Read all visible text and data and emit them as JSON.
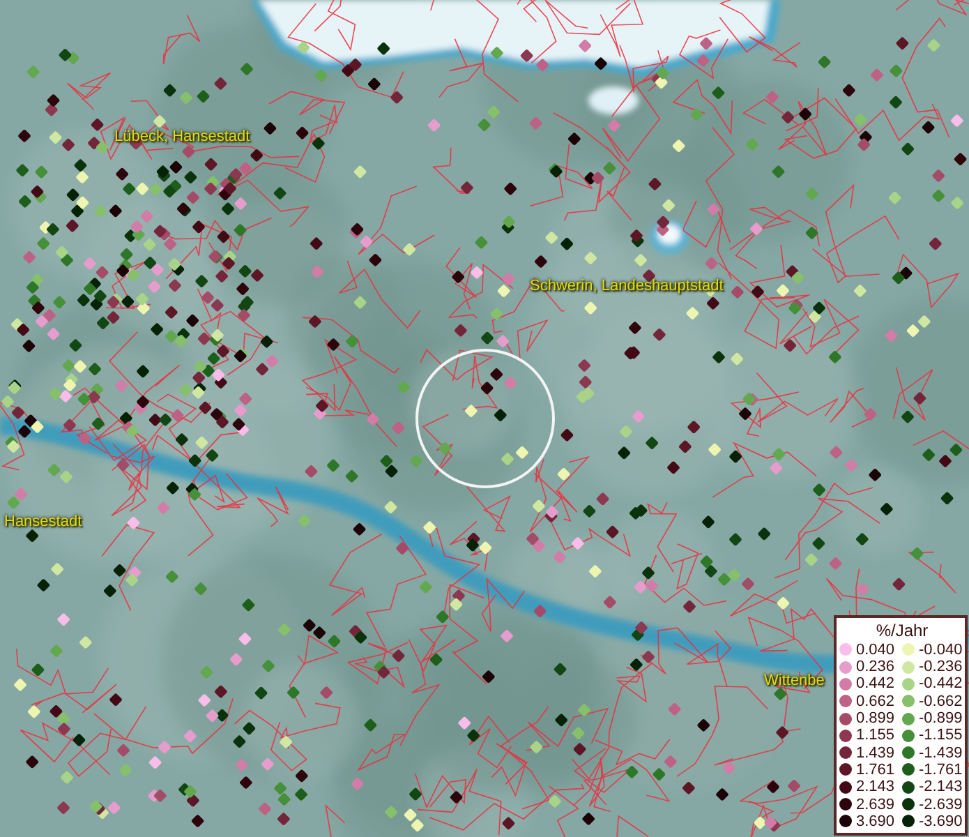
{
  "map": {
    "places": [
      {
        "name": "Lübeck, Hansestadt"
      },
      {
        "name": "Schwerin, Landeshauptstadt"
      },
      {
        "name": "Hansestadt"
      },
      {
        "name": "Wittenbe"
      }
    ]
  },
  "legend": {
    "title": "%/Jahr",
    "entries": [
      {
        "label": "0.040",
        "color": "#f8bde8"
      },
      {
        "label": "-0.040",
        "color": "#eef5b0"
      },
      {
        "label": "0.236",
        "color": "#e69ccc"
      },
      {
        "label": "-0.236",
        "color": "#cfe7a0"
      },
      {
        "label": "0.442",
        "color": "#d27ca8"
      },
      {
        "label": "-0.442",
        "color": "#a9d488"
      },
      {
        "label": "0.662",
        "color": "#bd6285"
      },
      {
        "label": "-0.662",
        "color": "#86c06a"
      },
      {
        "label": "0.899",
        "color": "#a44b68"
      },
      {
        "label": "-0.899",
        "color": "#62a84e"
      },
      {
        "label": "1.155",
        "color": "#8c3850"
      },
      {
        "label": "-1.155",
        "color": "#459038"
      },
      {
        "label": "1.439",
        "color": "#73263a"
      },
      {
        "label": "-1.439",
        "color": "#2e7628"
      },
      {
        "label": "1.761",
        "color": "#5c1626"
      },
      {
        "label": "-1.761",
        "color": "#1d5e1a"
      },
      {
        "label": "2.143",
        "color": "#430a16"
      },
      {
        "label": "-2.143",
        "color": "#124612"
      },
      {
        "label": "2.639",
        "color": "#2e040c"
      },
      {
        "label": "-2.639",
        "color": "#0a320b"
      },
      {
        "label": "3.690",
        "color": "#1c0206"
      },
      {
        "label": "-3.690",
        "color": "#052206"
      }
    ]
  }
}
